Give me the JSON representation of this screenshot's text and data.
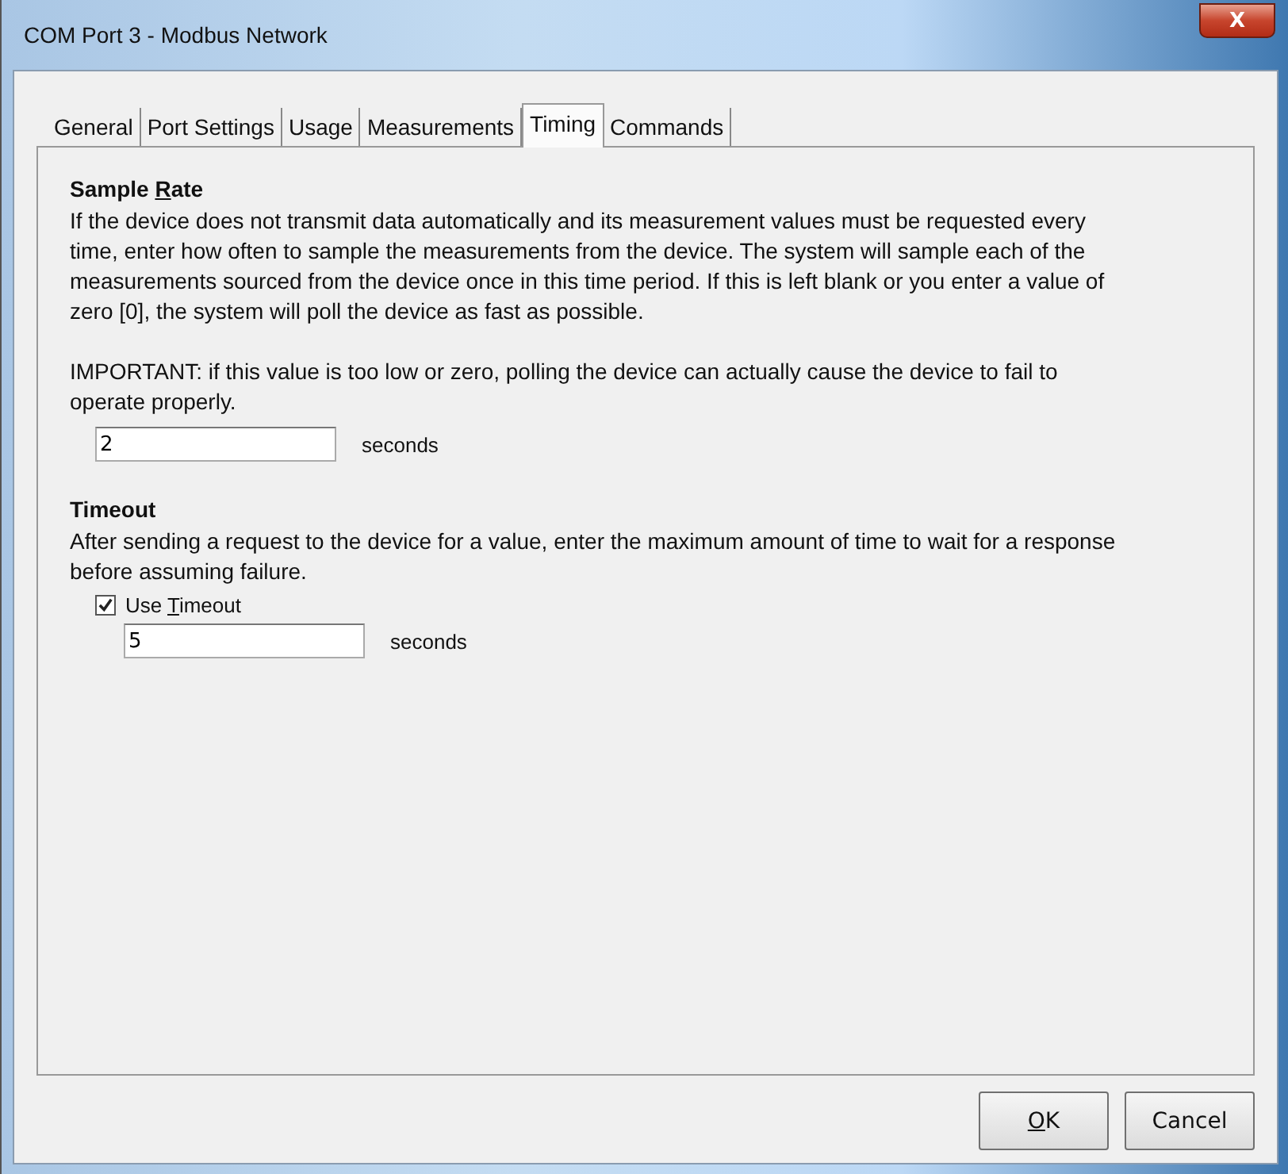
{
  "window": {
    "title": "COM Port 3 - Modbus Network",
    "close": "X"
  },
  "tabs": [
    {
      "label": "General",
      "selected": false
    },
    {
      "label": "Port Settings",
      "selected": false
    },
    {
      "label": "Usage",
      "selected": false
    },
    {
      "label": "Measurements",
      "selected": false
    },
    {
      "label": "Timing",
      "selected": true
    },
    {
      "label": "Commands",
      "selected": false
    }
  ],
  "sample_rate": {
    "heading": {
      "before": "Sample ",
      "key": "R",
      "after": "ate"
    },
    "description": "If the device does not transmit data automatically and its measurement values must be requested every time, enter how often to sample the measurements from the device. The system will sample each of the measurements sourced from the device once in this time period.  If this is left blank or you enter a value of zero [0], the system will poll the device as fast as possible.",
    "warning": "IMPORTANT:  if this value is too low or zero, polling the device can actually cause the device to fail to operate properly.",
    "value": "2",
    "unit": "seconds"
  },
  "timeout": {
    "heading": "Timeout",
    "description": "After sending a request to the device for a value, enter the maximum amount of time to wait for a response before assuming failure.",
    "checkbox": {
      "before": "Use ",
      "key": "T",
      "after": "imeout",
      "checked": true
    },
    "value": "5",
    "unit": "seconds"
  },
  "buttons": [
    {
      "key": "O",
      "after": "K"
    },
    {
      "before": "Cancel"
    }
  ]
}
